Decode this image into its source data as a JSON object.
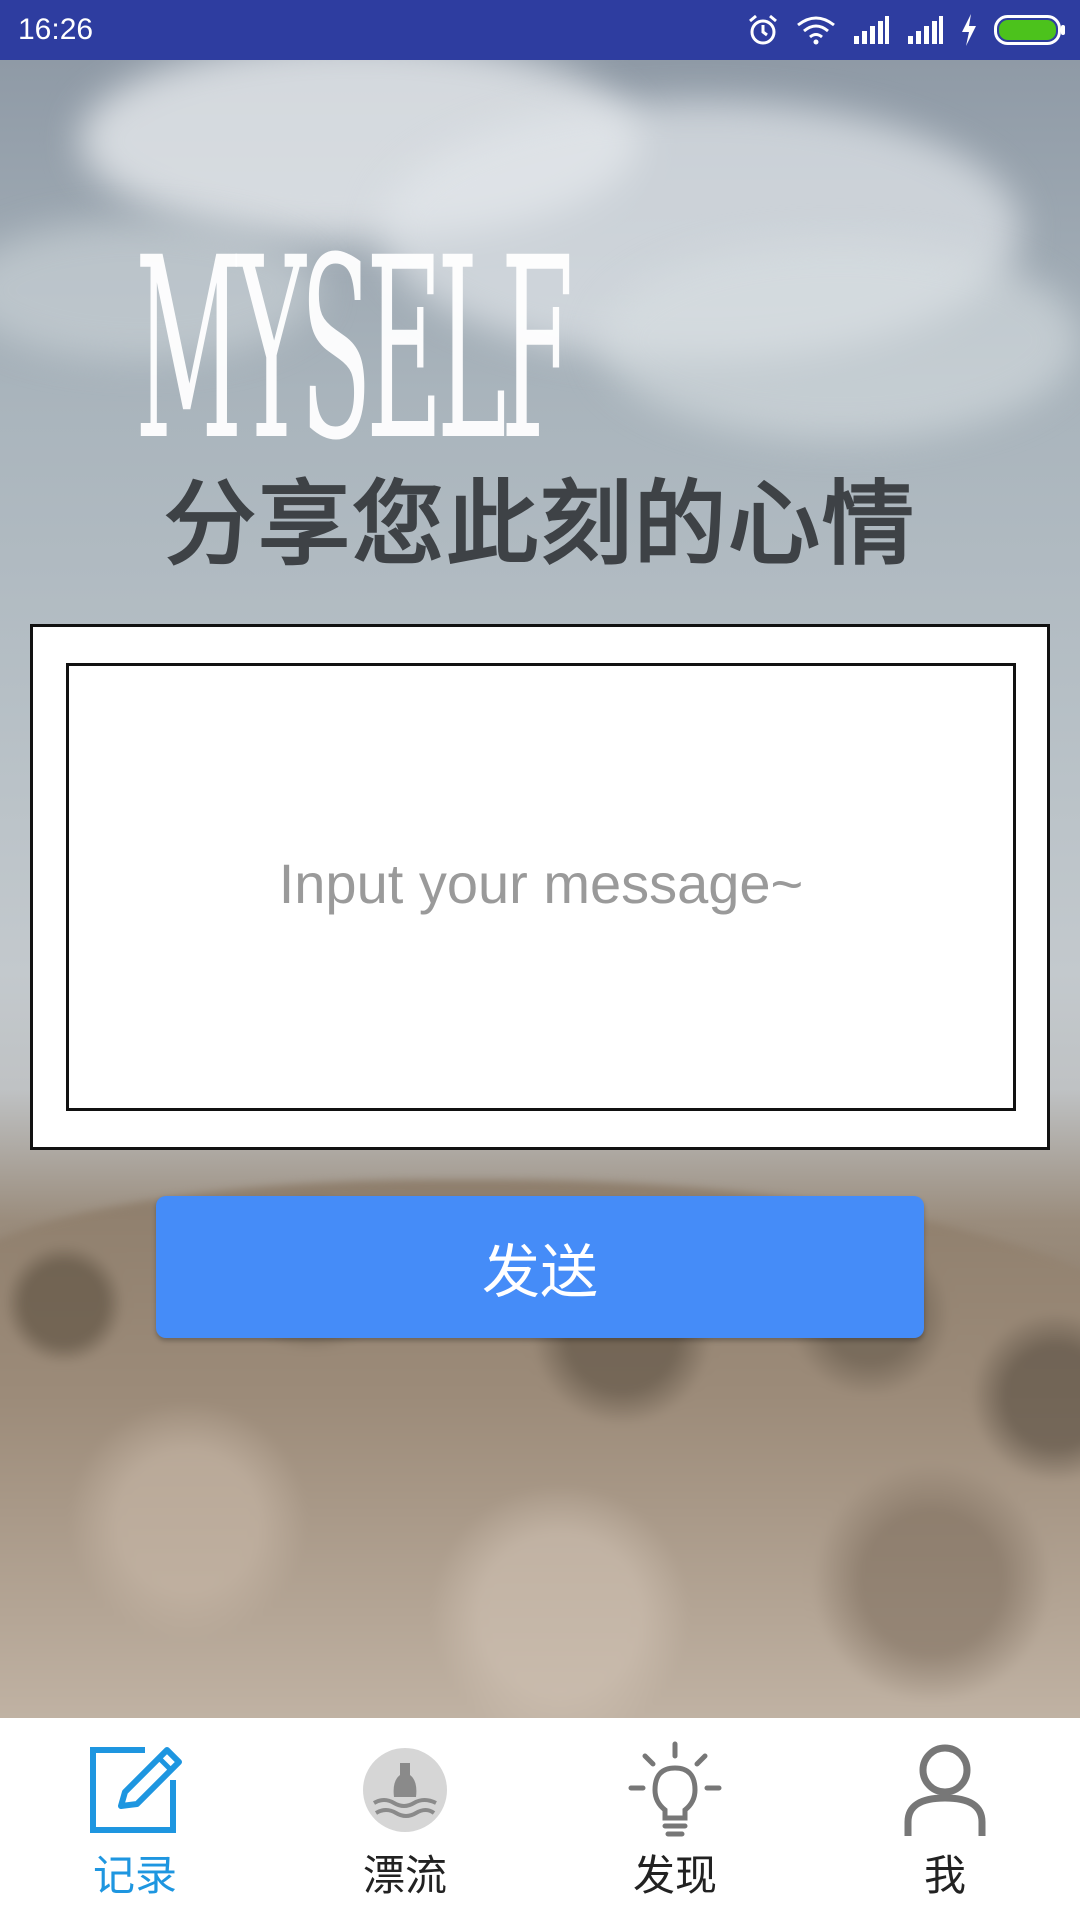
{
  "status_bar": {
    "time": "16:26",
    "icons": [
      "alarm-icon",
      "wifi-icon",
      "signal-icon",
      "signal-icon",
      "charging-icon",
      "battery-icon"
    ]
  },
  "logo_text": "MYSELF",
  "headline": "分享您此刻的心情",
  "message": {
    "placeholder": "Input your message~",
    "value": ""
  },
  "send_button": {
    "label": "发送"
  },
  "bottom_nav": {
    "items": [
      {
        "label": "记录",
        "icon": "edit-icon",
        "active": true
      },
      {
        "label": "漂流",
        "icon": "drift-bottle-icon",
        "active": false
      },
      {
        "label": "发现",
        "icon": "lightbulb-icon",
        "active": false
      },
      {
        "label": "我",
        "icon": "user-icon",
        "active": false
      }
    ]
  },
  "colors": {
    "status_bar": "#2e3da0",
    "accent": "#1e96e0",
    "send_button": "#458cf8",
    "battery": "#4cc21c"
  }
}
